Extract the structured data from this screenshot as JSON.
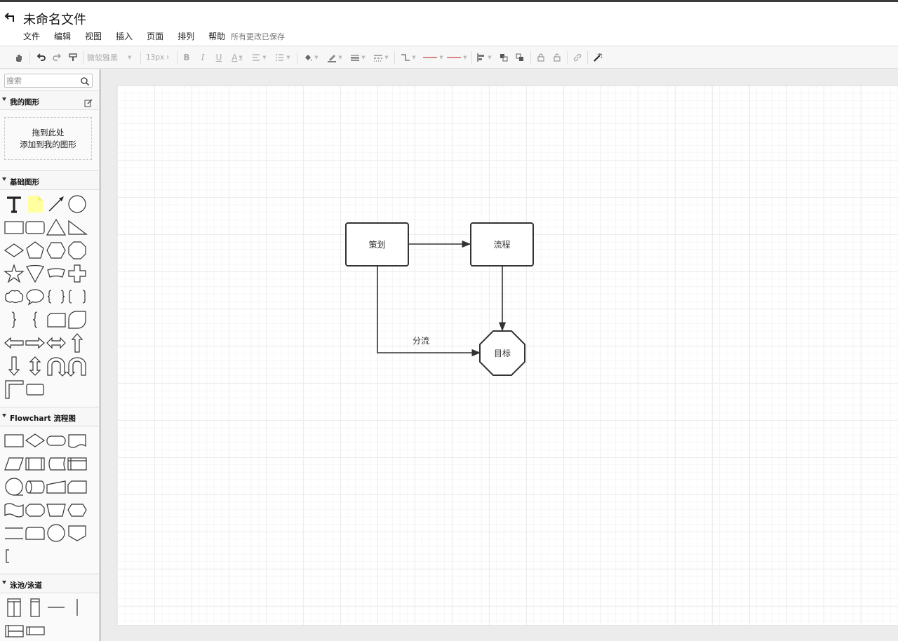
{
  "header": {
    "title": "未命名文件",
    "save_status": "所有更改已保存",
    "menu": [
      "文件",
      "编辑",
      "视图",
      "插入",
      "页面",
      "排列",
      "帮助"
    ]
  },
  "toolbar": {
    "font_family": "微软雅黑",
    "font_size": "13px",
    "bold": "B",
    "italic": "I",
    "underline": "U",
    "font_color": "A"
  },
  "sidebar": {
    "search_placeholder": "搜索",
    "sections": {
      "my_shapes": "我的图形",
      "basic": "基础图形",
      "flowchart": "Flowchart 流程图",
      "swimlane": "泳池/泳道"
    },
    "dropzone_line1": "拖到此处",
    "dropzone_line2": "添加到我的图形"
  },
  "diagram": {
    "nodes": {
      "plan": "策划",
      "process": "流程",
      "goal": "目标"
    },
    "edge_label": "分流"
  },
  "colors": {
    "stroke": "#333333",
    "note_fill": "#ffffa0",
    "grid": "#ececec"
  }
}
